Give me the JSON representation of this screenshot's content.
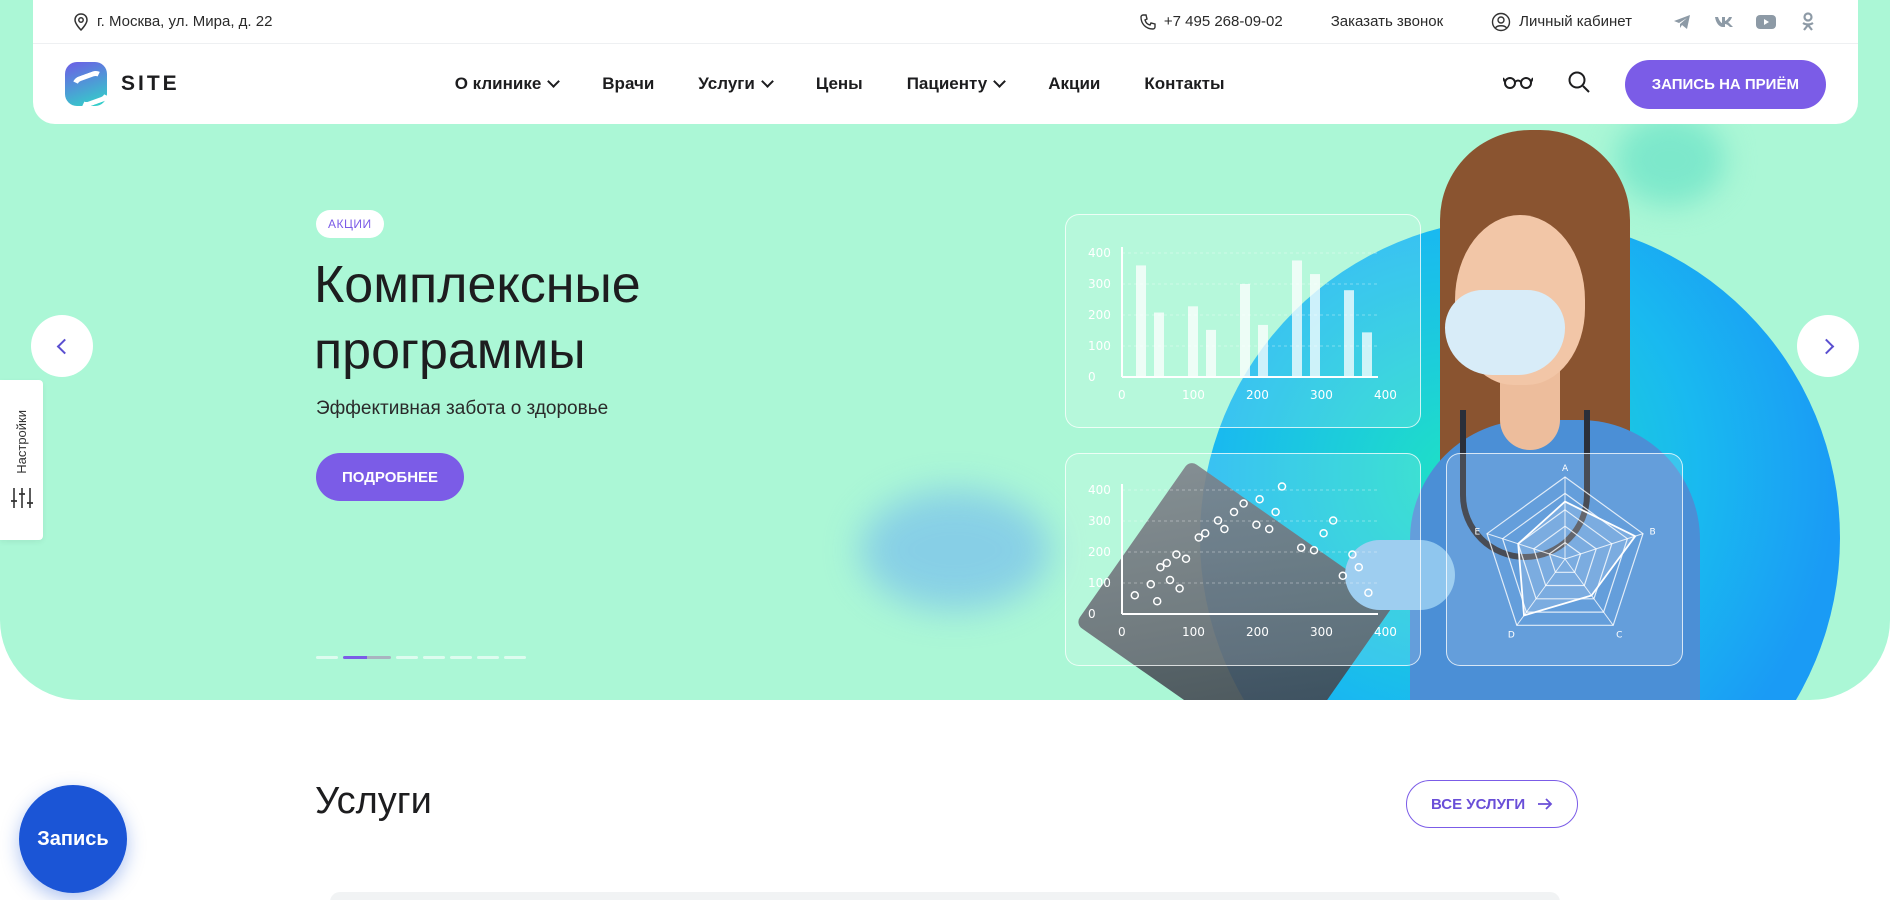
{
  "topbar": {
    "address": "г. Москва, ул. Мира, д. 22",
    "phone": "+7 495 268-09-02",
    "callback": "Заказать звонок",
    "cabinet": "Личный кабинет",
    "social": [
      "telegram-icon",
      "vk-icon",
      "youtube-icon",
      "ok-icon"
    ]
  },
  "nav": {
    "logo_text": "SITE",
    "menu": [
      {
        "label": "О клинике",
        "dropdown": true
      },
      {
        "label": "Врачи",
        "dropdown": false
      },
      {
        "label": "Услуги",
        "dropdown": true
      },
      {
        "label": "Цены",
        "dropdown": false
      },
      {
        "label": "Пациенту",
        "dropdown": true
      },
      {
        "label": "Акции",
        "dropdown": false
      },
      {
        "label": "Контакты",
        "dropdown": false
      }
    ],
    "cta": "ЗАПИСЬ НА ПРИЁМ"
  },
  "hero": {
    "badge": "АКЦИИ",
    "title_line1": "Комплексные",
    "title_line2": "программы",
    "subtitle": "Эффективная забота о здоровье",
    "button": "ПОДРОБНЕЕ",
    "slides": 7,
    "active_slide": 2
  },
  "glass_charts": {
    "bar_y_ticks": [
      "400",
      "300",
      "200",
      "100",
      "0"
    ],
    "bar_x_ticks": [
      "0",
      "100",
      "200",
      "300",
      "400"
    ],
    "scatter_y_ticks": [
      "400",
      "300",
      "200",
      "100",
      "0"
    ],
    "scatter_x_ticks": [
      "0",
      "100",
      "200",
      "300",
      "400"
    ],
    "radar_labels": [
      "A",
      "B",
      "C",
      "D",
      "E"
    ]
  },
  "settings": {
    "label": "Настройки"
  },
  "services": {
    "title": "Услуги",
    "all_button": "ВСЕ УСЛУГИ"
  },
  "float_button": "Запись",
  "colors": {
    "accent": "#7b5ce7",
    "hero_bg": "#abf7d6",
    "float": "#1b55d6"
  }
}
